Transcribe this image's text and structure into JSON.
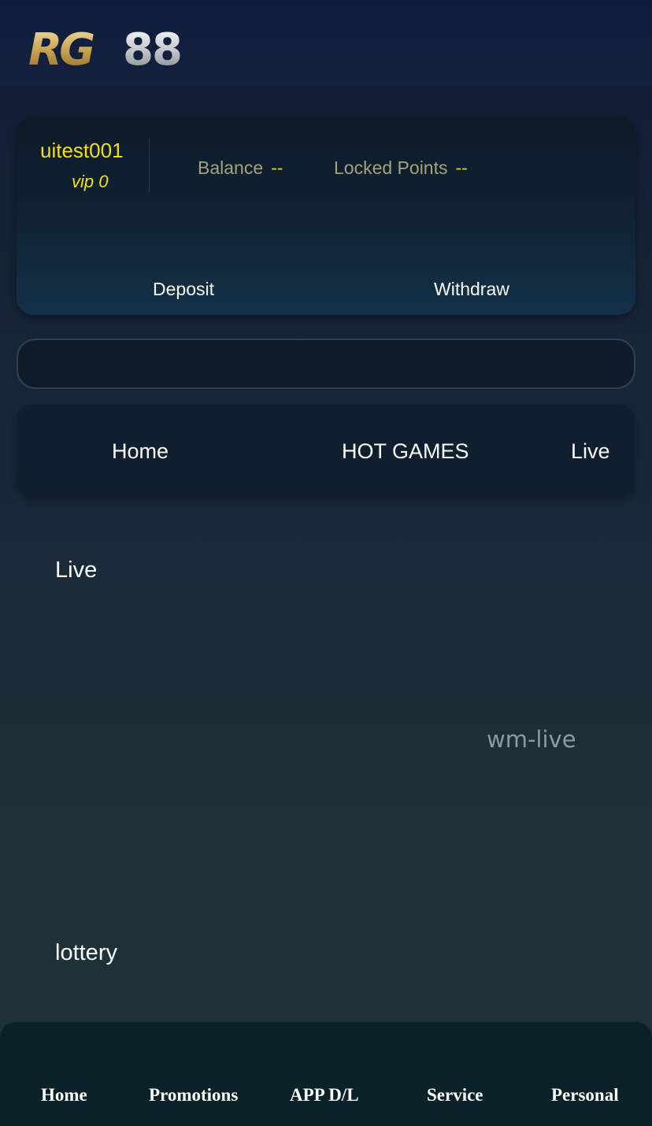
{
  "header": {
    "logo_text": "RG88"
  },
  "user": {
    "username": "uitest001",
    "vip": "vip 0",
    "balance_label": "Balance",
    "balance_value": "--",
    "locked_label": "Locked Points",
    "locked_value": "--",
    "deposit_label": "Deposit",
    "withdraw_label": "Withdraw"
  },
  "nav_tabs": [
    "Home",
    "HOT GAMES",
    "Live"
  ],
  "sections": {
    "live_title": "Live",
    "live_game": "wm-live",
    "lottery_title": "lottery"
  },
  "bottom_nav": [
    "Home",
    "Promotions",
    "APP D/L",
    "Service",
    "Personal"
  ],
  "colors": {
    "accent_yellow": "#f5e000",
    "stat_label": "#a8a27a",
    "background_top": "#101b33",
    "bottom_nav_bg": "#0a2128"
  }
}
